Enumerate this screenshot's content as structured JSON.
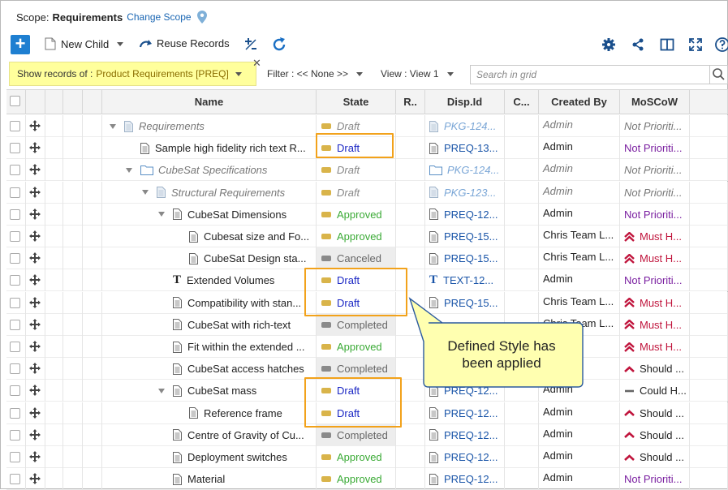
{
  "scope": {
    "label": "Scope:",
    "value": "Requirements",
    "change": "Change Scope"
  },
  "toolbar": {
    "new_child": "New Child",
    "reuse_records": "Reuse Records"
  },
  "filterbar": {
    "show_records_label": "Show records of :",
    "show_records_value": "Product Requirements [PREQ]",
    "filter": "Filter : << None >>",
    "view": "View : View 1",
    "search_placeholder": "Search in grid"
  },
  "columns": [
    "Name",
    "State",
    "R..",
    "Disp.Id",
    "C...",
    "Created By",
    "MoSCoW"
  ],
  "colors": {
    "draft": "#1b27c4",
    "approved": "#3aaa35",
    "canceled": "#666666",
    "completed": "#666666",
    "draft_icon": "#d9b44a",
    "approved_icon": "#d9b44a",
    "gray_icon": "#8a8a8a",
    "must": "#c0143c",
    "not_prioritized": "#7a1fa0",
    "highlight": "#f2a21b",
    "callout_fill": "#ffffb0",
    "callout_border": "#2b5a9e"
  },
  "rows": [
    {
      "name": "Requirements",
      "icon": "doc-gray-icon",
      "indent": 0,
      "tree": "expanded",
      "italic": true,
      "state": "Draft",
      "state_style": "plain-italic",
      "disp": "PKG-124...",
      "disp_icon": "doc-gray-icon",
      "disp_italic": true,
      "created_by": "Admin",
      "created_italic": true,
      "moscow": "Not Prioriti...",
      "moscow_style": "plain-italic"
    },
    {
      "name": "Sample high fidelity rich text R...",
      "icon": "doc-icon",
      "indent": 1,
      "tree": "none",
      "italic": false,
      "state": "Draft",
      "state_style": "draft",
      "disp": "PREQ-13...",
      "disp_icon": "doc-icon",
      "disp_italic": false,
      "created_by": "Admin",
      "created_italic": false,
      "moscow": "Not Prioriti...",
      "moscow_style": "not"
    },
    {
      "name": "CubeSat Specifications",
      "icon": "folder-icon",
      "indent": 1,
      "tree": "expanded",
      "italic": true,
      "state": "Draft",
      "state_style": "plain-italic",
      "disp": "PKG-124...",
      "disp_icon": "folder-icon",
      "disp_italic": true,
      "created_by": "Admin",
      "created_italic": true,
      "moscow": "Not Prioriti...",
      "moscow_style": "plain-italic"
    },
    {
      "name": "Structural Requirements",
      "icon": "doc-gray-icon",
      "indent": 2,
      "tree": "expanded",
      "italic": true,
      "state": "Draft",
      "state_style": "plain-italic",
      "disp": "PKG-123...",
      "disp_icon": "doc-gray-icon",
      "disp_italic": true,
      "created_by": "Admin",
      "created_italic": true,
      "moscow": "Not Prioriti...",
      "moscow_style": "plain-italic"
    },
    {
      "name": "CubeSat Dimensions",
      "icon": "doc-icon",
      "indent": 3,
      "tree": "expanded",
      "italic": false,
      "state": "Approved",
      "state_style": "approved",
      "disp": "PREQ-12...",
      "disp_icon": "doc-icon",
      "disp_italic": false,
      "created_by": "Admin",
      "created_italic": false,
      "moscow": "Not Prioriti...",
      "moscow_style": "not"
    },
    {
      "name": "Cubesat size and Fo...",
      "icon": "doc-icon",
      "indent": 4,
      "tree": "none",
      "italic": false,
      "state": "Approved",
      "state_style": "approved",
      "disp": "PREQ-15...",
      "disp_icon": "doc-icon",
      "disp_italic": false,
      "created_by": "Chris Team L...",
      "created_italic": false,
      "moscow": "Must H...",
      "moscow_style": "must"
    },
    {
      "name": "CubeSat Design sta...",
      "icon": "doc-icon",
      "indent": 4,
      "tree": "none",
      "italic": false,
      "state": "Canceled",
      "state_style": "canceled",
      "disp": "PREQ-15...",
      "disp_icon": "doc-icon",
      "disp_italic": false,
      "created_by": "Chris Team L...",
      "created_italic": false,
      "moscow": "Must H...",
      "moscow_style": "must"
    },
    {
      "name": "Extended Volumes",
      "icon": "text-icon",
      "indent": 3,
      "tree": "none",
      "italic": false,
      "state": "Draft",
      "state_style": "draft",
      "disp": "TEXT-12...",
      "disp_icon": "text-icon",
      "disp_italic": false,
      "created_by": "Admin",
      "created_italic": false,
      "moscow": "Not Prioriti...",
      "moscow_style": "not"
    },
    {
      "name": "Compatibility with stan...",
      "icon": "doc-icon",
      "indent": 3,
      "tree": "none",
      "italic": false,
      "state": "Draft",
      "state_style": "draft",
      "disp": "PREQ-15...",
      "disp_icon": "doc-icon",
      "disp_italic": false,
      "created_by": "Chris Team L...",
      "created_italic": false,
      "moscow": "Must H...",
      "moscow_style": "must"
    },
    {
      "name": "CubeSat with rich-text",
      "icon": "doc-icon",
      "indent": 3,
      "tree": "none",
      "italic": false,
      "state": "Completed",
      "state_style": "completed",
      "disp": "",
      "disp_icon": "",
      "disp_italic": false,
      "created_by": "Chris Team L...",
      "created_italic": false,
      "moscow": "Must H...",
      "moscow_style": "must"
    },
    {
      "name": "Fit within the extended ...",
      "icon": "doc-icon",
      "indent": 3,
      "tree": "none",
      "italic": false,
      "state": "Approved",
      "state_style": "approved",
      "disp": "",
      "disp_icon": "",
      "disp_italic": false,
      "created_by": "",
      "created_italic": false,
      "moscow": "Must H...",
      "moscow_style": "must"
    },
    {
      "name": "CubeSat access hatches",
      "icon": "doc-icon",
      "indent": 3,
      "tree": "none",
      "italic": false,
      "state": "Completed",
      "state_style": "completed",
      "disp": "",
      "disp_icon": "",
      "disp_italic": false,
      "created_by": "",
      "created_italic": false,
      "moscow": "Should ...",
      "moscow_style": "should"
    },
    {
      "name": "CubeSat mass",
      "icon": "doc-icon",
      "indent": 3,
      "tree": "expanded",
      "italic": false,
      "state": "Draft",
      "state_style": "draft",
      "disp": "PREQ-12...",
      "disp_icon": "doc-icon",
      "disp_italic": false,
      "created_by": "Admin",
      "created_italic": false,
      "moscow": "Could H...",
      "moscow_style": "could"
    },
    {
      "name": "Reference frame",
      "icon": "doc-icon",
      "indent": 4,
      "tree": "none",
      "italic": false,
      "state": "Draft",
      "state_style": "draft",
      "disp": "PREQ-12...",
      "disp_icon": "doc-icon",
      "disp_italic": false,
      "created_by": "Admin",
      "created_italic": false,
      "moscow": "Should ...",
      "moscow_style": "should"
    },
    {
      "name": "Centre of Gravity of Cu...",
      "icon": "doc-icon",
      "indent": 3,
      "tree": "none",
      "italic": false,
      "state": "Completed",
      "state_style": "completed",
      "disp": "PREQ-12...",
      "disp_icon": "doc-icon",
      "disp_italic": false,
      "created_by": "Admin",
      "created_italic": false,
      "moscow": "Should ...",
      "moscow_style": "should"
    },
    {
      "name": "Deployment switches",
      "icon": "doc-icon",
      "indent": 3,
      "tree": "none",
      "italic": false,
      "state": "Approved",
      "state_style": "approved",
      "disp": "PREQ-12...",
      "disp_icon": "doc-icon",
      "disp_italic": false,
      "created_by": "Admin",
      "created_italic": false,
      "moscow": "Should ...",
      "moscow_style": "should"
    },
    {
      "name": "Material",
      "icon": "doc-icon",
      "indent": 3,
      "tree": "none",
      "italic": false,
      "state": "Approved",
      "state_style": "approved",
      "disp": "PREQ-12...",
      "disp_icon": "doc-icon",
      "disp_italic": false,
      "created_by": "Admin",
      "created_italic": false,
      "moscow": "Not Prioriti...",
      "moscow_style": "not"
    }
  ],
  "callout": {
    "line1": "Defined Style has",
    "line2": "been applied"
  }
}
